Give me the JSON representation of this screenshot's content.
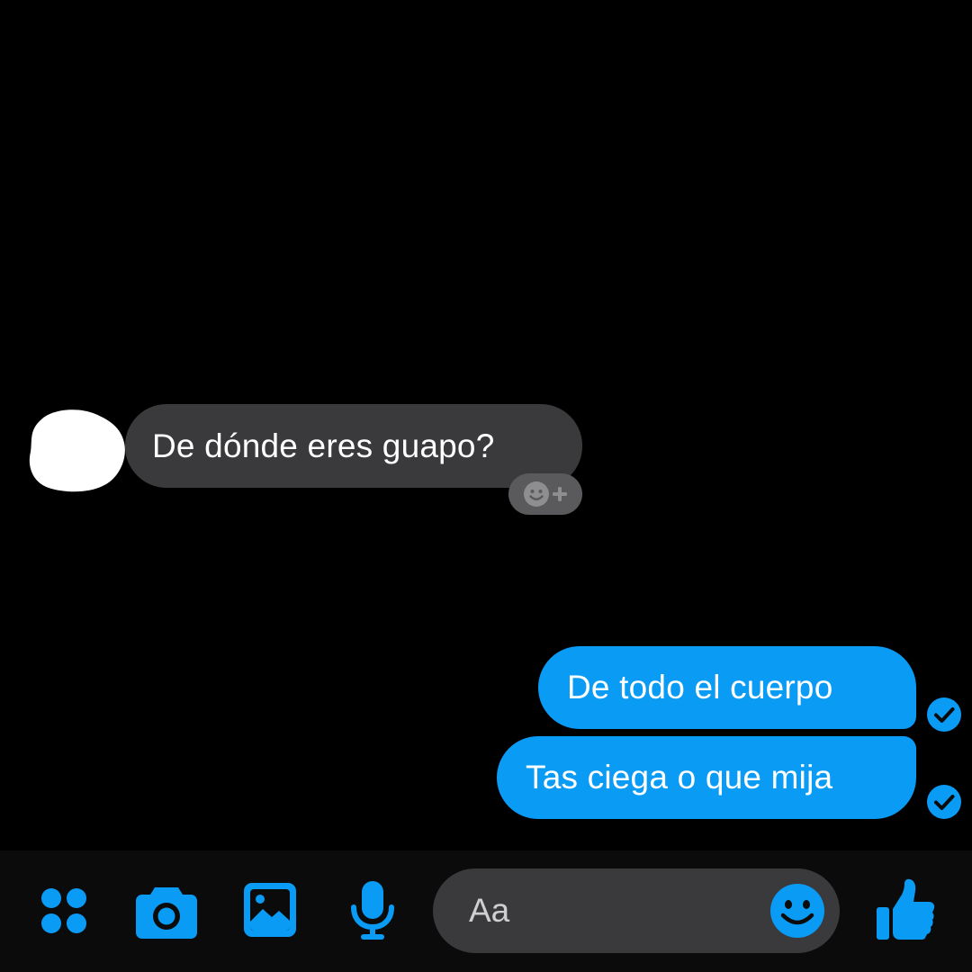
{
  "conversation": {
    "incoming": [
      {
        "text": "De dónde eres guapo?"
      }
    ],
    "outgoing": [
      {
        "text": "De todo el cuerpo"
      },
      {
        "text": "Tas ciega o que mija"
      }
    ]
  },
  "composer": {
    "placeholder": "Aa"
  },
  "toolbar": {
    "icons": [
      "apps-icon",
      "camera-icon",
      "gallery-icon",
      "microphone-icon",
      "emoji-icon",
      "thumbs-up-icon"
    ]
  },
  "colors": {
    "accent": "#0a9bf5",
    "incoming_bubble": "#3a3a3c",
    "background": "#000000"
  }
}
